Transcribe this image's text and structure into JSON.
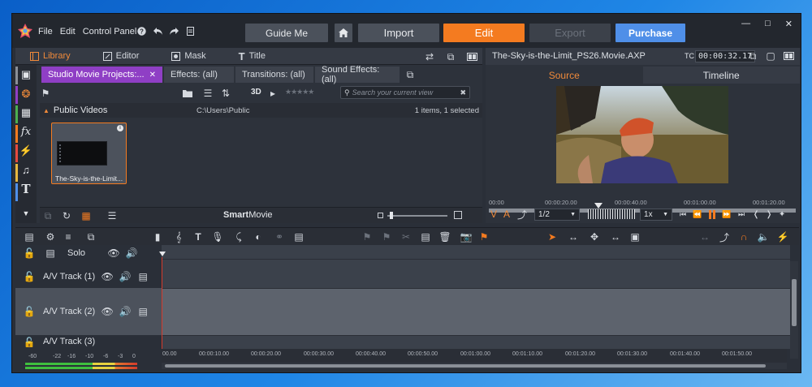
{
  "menu": [
    "File",
    "Edit",
    "Control Panel"
  ],
  "top_buttons": {
    "guide": "Guide Me",
    "import": "Import",
    "edit": "Edit",
    "export": "Export",
    "purchase": "Purchase"
  },
  "colors": {
    "accent": "#f47b20",
    "purchase": "#4f8fe8",
    "active_collection": "#8f3fc5",
    "playhead": "#d33b2c"
  },
  "library": {
    "tabs": [
      "Library",
      "Editor",
      "Mask",
      "Title"
    ],
    "collection_tabs": [
      "Studio Movie Projects:...",
      "Effects: (all)",
      "Transitions: (all)",
      "Sound Effects: (all)"
    ],
    "view_3d": "3D",
    "rating": "★★★★★",
    "search_placeholder": "Search your current view",
    "folder": "Public Videos",
    "path": "C:\\Users\\Public",
    "count": "1 items, 1 selected",
    "item_label": "The-Sky-is-the-Limit...",
    "smartmovie_bold": "Smart",
    "smartmovie_rest": "Movie"
  },
  "player": {
    "title": "The-Sky-is-the-Limit_PS26.Movie.AXP",
    "tc_label": "TC",
    "timecode": "00:00:32.17",
    "tab_source": "Source",
    "tab_timeline": "Timeline",
    "ruler": [
      "00:00",
      "00:00:20.00",
      "00:00:40.00",
      "00:01:00.00",
      "00:01:20.00"
    ],
    "speed": "1/2",
    "rate": "1x",
    "v_label": "V",
    "a_label": "A"
  },
  "timeline": {
    "solo": "Solo",
    "tracks": [
      "A/V Track (1)",
      "A/V Track (2)",
      "A/V Track (3)"
    ],
    "ruler": [
      "00.00",
      "00:00:10.00",
      "00:00:20.00",
      "00:00:30.00",
      "00:00:40.00",
      "00:00:50.00",
      "00:01:00.00",
      "00:01:10.00",
      "00:01:20.00",
      "00:01:30.00",
      "00:01:40.00",
      "00:01:50.00"
    ],
    "meter_labels": [
      "-60",
      "-22",
      "-16",
      "-10",
      "-6",
      "-3",
      "0"
    ]
  }
}
